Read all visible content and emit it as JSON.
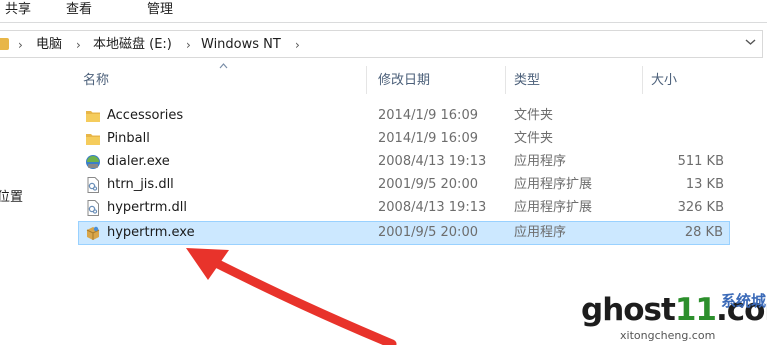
{
  "ribbon": {
    "tabs": [
      "共享",
      "查看",
      "管理"
    ]
  },
  "address": {
    "crumbs": [
      "电脑",
      "本地磁盘 (E:)",
      "Windows NT"
    ],
    "separator": "›",
    "dropdown_icon": "chevron-down-icon"
  },
  "nav": {
    "partial_label": "位置"
  },
  "columns": {
    "name": "名称",
    "date": "修改日期",
    "type": "类型",
    "size": "大小"
  },
  "files": [
    {
      "icon": "folder-icon",
      "name": "Accessories",
      "date": "2014/1/9 16:09",
      "type": "文件夹",
      "size": ""
    },
    {
      "icon": "folder-icon",
      "name": "Pinball",
      "date": "2014/1/9 16:09",
      "type": "文件夹",
      "size": ""
    },
    {
      "icon": "dialer-exe-icon",
      "name": "dialer.exe",
      "date": "2008/4/13 19:13",
      "type": "应用程序",
      "size": "511 KB"
    },
    {
      "icon": "dll-file-icon",
      "name": "htrn_jis.dll",
      "date": "2001/9/5 20:00",
      "type": "应用程序扩展",
      "size": "13 KB"
    },
    {
      "icon": "dll-file-icon",
      "name": "hypertrm.dll",
      "date": "2008/4/13 19:13",
      "type": "应用程序扩展",
      "size": "326 KB"
    },
    {
      "icon": "hyperterminal-exe-icon",
      "name": "hypertrm.exe",
      "date": "2001/9/5 20:00",
      "type": "应用程序",
      "size": "28 KB",
      "selected": true
    }
  ],
  "watermark": {
    "text_pre": "ghost",
    "text_one": "11",
    "text_post": ".com",
    "sub": "xitongcheng.com",
    "cn": "系统城"
  },
  "colors": {
    "selection_bg": "#cce8ff",
    "selection_border": "#99d1ff",
    "folder": "#e8b648",
    "arrow": "#e8332b"
  }
}
